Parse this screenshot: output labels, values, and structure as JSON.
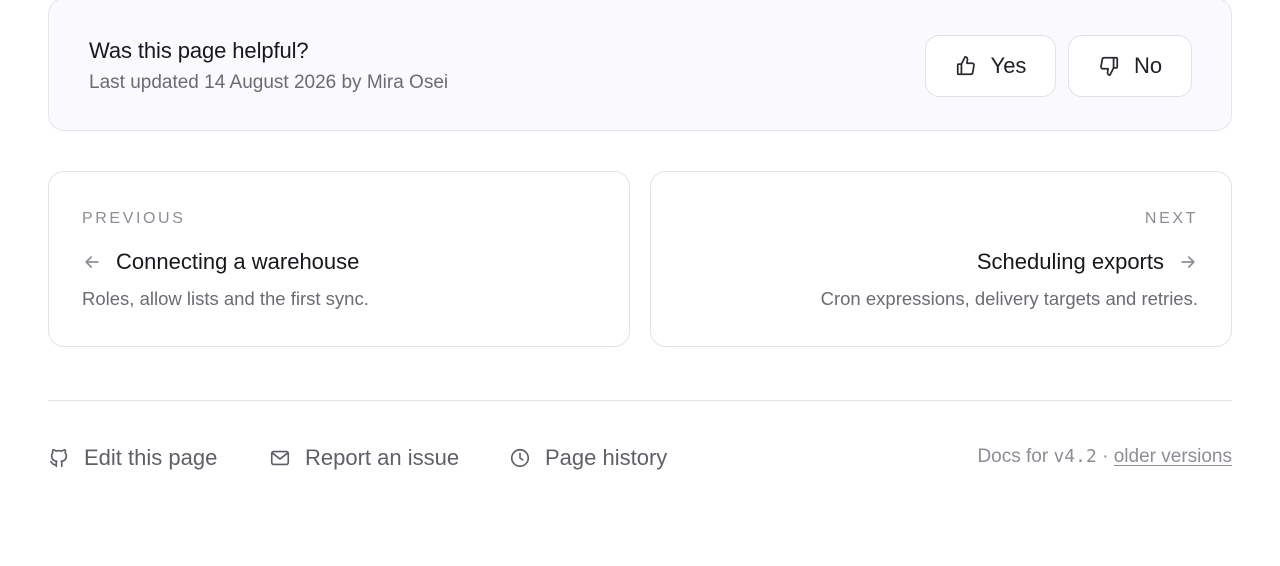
{
  "feedback": {
    "title": "Was this page helpful?",
    "meta": "Last updated 14 August 2026 by Mira Osei",
    "yes_label": "Yes",
    "no_label": "No",
    "yes_icon": "thumbs-up-icon",
    "no_icon": "thumbs-down-icon"
  },
  "pager": {
    "previous": {
      "eyebrow": "PREVIOUS",
      "title": "Connecting a warehouse",
      "description": "Roles, allow lists and the first sync.",
      "icon": "arrow-left-icon"
    },
    "next": {
      "eyebrow": "NEXT",
      "title": "Scheduling exports",
      "description": "Cron expressions, delivery targets and retries.",
      "icon": "arrow-right-icon"
    }
  },
  "footer": {
    "links": [
      {
        "label": "Edit this page",
        "icon": "github-icon"
      },
      {
        "label": "Report an issue",
        "icon": "mail-icon"
      },
      {
        "label": "Page history",
        "icon": "clock-icon"
      }
    ],
    "version_prefix": "Docs for ",
    "version": "v4.2",
    "separator": " · ",
    "older_versions_label": "older versions"
  },
  "colors": {
    "feedback_bg": "#faf9fd",
    "border": "#e3e2e8",
    "text_primary": "#17171c",
    "text_muted": "#6b6b74",
    "text_faint": "#8d8d96"
  }
}
